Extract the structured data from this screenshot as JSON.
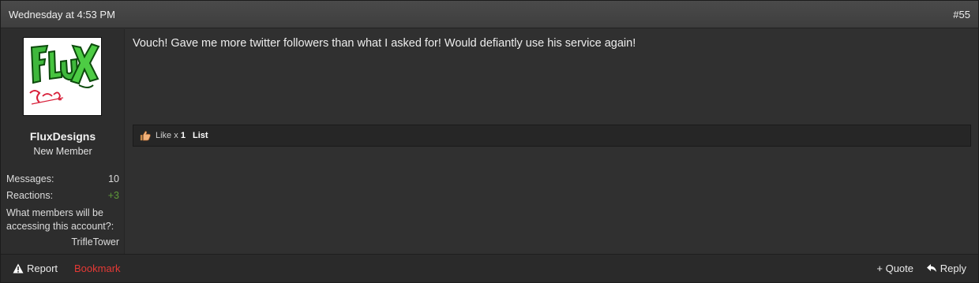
{
  "header": {
    "date": "Wednesday at 4:53 PM",
    "post_number": "#55"
  },
  "user": {
    "avatar_icon": "flux-designs-logo-icon",
    "username": "FluxDesigns",
    "title": "New Member",
    "stats": {
      "messages_label": "Messages:",
      "messages_value": "10",
      "reactions_label": "Reactions:",
      "reactions_value": "+3",
      "custom_label": "What members will be accessing this account?:",
      "custom_value": "TrifleTower"
    }
  },
  "post": {
    "message": "Vouch! Gave me more twitter followers than what I asked for! Would defiantly use his service again!"
  },
  "reactions": {
    "icon": "thumbs-up-icon",
    "like_label": "Like x",
    "like_count": "1",
    "list_label": "List"
  },
  "footer": {
    "report_label": "Report",
    "bookmark_label": "Bookmark",
    "quote_label": "+ Quote",
    "reply_label": "Reply"
  },
  "colors": {
    "bookmark": "#e53935",
    "reactions_positive": "#5f9b3a"
  }
}
